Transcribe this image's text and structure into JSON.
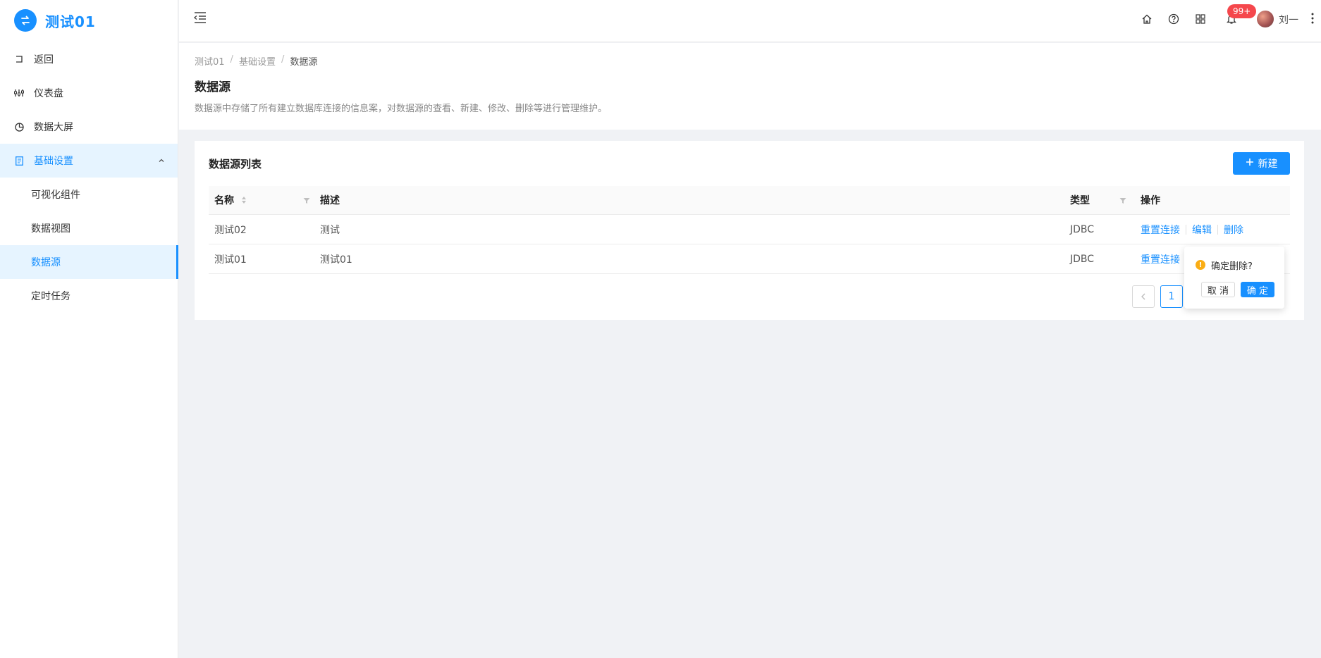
{
  "app": {
    "title": "测试01",
    "logo_icon": "switch-arrows-icon",
    "accent_color": "#1890ff"
  },
  "sidebar": {
    "items": [
      {
        "label": "返回",
        "icon": "return-icon"
      },
      {
        "label": "仪表盘",
        "icon": "sliders-icon"
      },
      {
        "label": "数据大屏",
        "icon": "pie-icon"
      },
      {
        "label": "基础设置",
        "icon": "document-icon",
        "expanded": true
      }
    ],
    "sub_items": [
      {
        "label": "可视化组件"
      },
      {
        "label": "数据视图"
      },
      {
        "label": "数据源",
        "active": true
      },
      {
        "label": "定时任务"
      }
    ]
  },
  "header": {
    "notification_badge": "99+",
    "username": "刘一",
    "icons": [
      "menu-fold-icon",
      "home-icon",
      "help-icon",
      "apps-icon",
      "bell-icon",
      "more-vertical-icon"
    ]
  },
  "breadcrumb": [
    "测试01",
    "基础设置",
    "数据源"
  ],
  "page": {
    "title": "数据源",
    "description": "数据源中存储了所有建立数据库连接的信息案，对数据源的查看、新建、修改、删除等进行管理维护。"
  },
  "card": {
    "title": "数据源列表",
    "new_button": "新建"
  },
  "table": {
    "columns": [
      "名称",
      "描述",
      "类型",
      "操作"
    ],
    "rows": [
      {
        "name": "测试02",
        "description": "测试",
        "type": "JDBC",
        "actions": [
          "重置连接",
          "编辑",
          "删除"
        ]
      },
      {
        "name": "测试01",
        "description": "测试01",
        "type": "JDBC",
        "actions": [
          "重置连接"
        ]
      }
    ]
  },
  "pagination": {
    "current": "1"
  },
  "popconfirm": {
    "message": "确定删除?",
    "cancel": "取 消",
    "ok": "确 定"
  }
}
